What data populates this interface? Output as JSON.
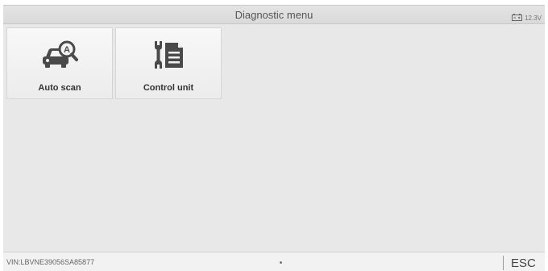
{
  "header": {
    "title": "Diagnostic menu",
    "battery_icon": "battery-icon",
    "battery_voltage": "12.3V"
  },
  "tiles": [
    {
      "label": "Auto scan",
      "icon": "car-auto-scan-icon"
    },
    {
      "label": "Control unit",
      "icon": "wrench-document-icon"
    }
  ],
  "footer": {
    "vin": "VIN:LBVNE39056SA85877",
    "esc_label": "ESC"
  },
  "colors": {
    "content_bg": "#e8e8e8",
    "icon": "#4a4a4a"
  }
}
